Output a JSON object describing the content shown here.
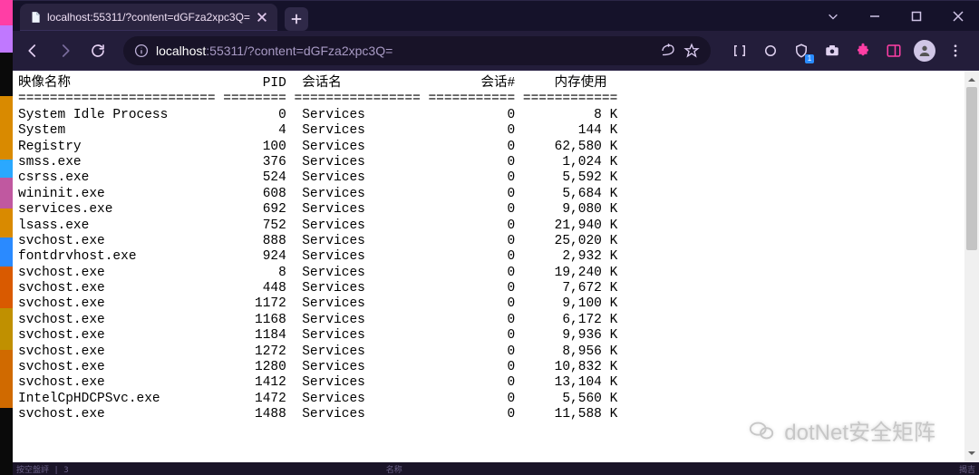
{
  "tab": {
    "title": "localhost:55311/?content=dGFza2xpc3Q="
  },
  "url": {
    "host": "localhost",
    "rest": ":55311/?content=dGFza2xpc3Q="
  },
  "watermark": "dotNet安全矩阵",
  "headers": {
    "name": "映像名称",
    "pid": "PID",
    "session": "会话名",
    "session_num": "会话#",
    "mem": "内存使用"
  },
  "separator": {
    "name": "=========================",
    "pid": "========",
    "session": "================",
    "session_num": "===========",
    "mem": "============"
  },
  "status": {
    "left": "按空盤評 | 3",
    "mid": "名称",
    "right": "揭吉"
  },
  "rows": [
    {
      "name": "System Idle Process",
      "pid": "0",
      "session": "Services",
      "snum": "0",
      "mem": "8 K"
    },
    {
      "name": "System",
      "pid": "4",
      "session": "Services",
      "snum": "0",
      "mem": "144 K"
    },
    {
      "name": "Registry",
      "pid": "100",
      "session": "Services",
      "snum": "0",
      "mem": "62,580 K"
    },
    {
      "name": "smss.exe",
      "pid": "376",
      "session": "Services",
      "snum": "0",
      "mem": "1,024 K"
    },
    {
      "name": "csrss.exe",
      "pid": "524",
      "session": "Services",
      "snum": "0",
      "mem": "5,592 K"
    },
    {
      "name": "wininit.exe",
      "pid": "608",
      "session": "Services",
      "snum": "0",
      "mem": "5,684 K"
    },
    {
      "name": "services.exe",
      "pid": "692",
      "session": "Services",
      "snum": "0",
      "mem": "9,080 K"
    },
    {
      "name": "lsass.exe",
      "pid": "752",
      "session": "Services",
      "snum": "0",
      "mem": "21,940 K"
    },
    {
      "name": "svchost.exe",
      "pid": "888",
      "session": "Services",
      "snum": "0",
      "mem": "25,020 K"
    },
    {
      "name": "fontdrvhost.exe",
      "pid": "924",
      "session": "Services",
      "snum": "0",
      "mem": "2,932 K"
    },
    {
      "name": "svchost.exe",
      "pid": "8",
      "session": "Services",
      "snum": "0",
      "mem": "19,240 K"
    },
    {
      "name": "svchost.exe",
      "pid": "448",
      "session": "Services",
      "snum": "0",
      "mem": "7,672 K"
    },
    {
      "name": "svchost.exe",
      "pid": "1172",
      "session": "Services",
      "snum": "0",
      "mem": "9,100 K"
    },
    {
      "name": "svchost.exe",
      "pid": "1168",
      "session": "Services",
      "snum": "0",
      "mem": "6,172 K"
    },
    {
      "name": "svchost.exe",
      "pid": "1184",
      "session": "Services",
      "snum": "0",
      "mem": "9,936 K"
    },
    {
      "name": "svchost.exe",
      "pid": "1272",
      "session": "Services",
      "snum": "0",
      "mem": "8,956 K"
    },
    {
      "name": "svchost.exe",
      "pid": "1280",
      "session": "Services",
      "snum": "0",
      "mem": "10,832 K"
    },
    {
      "name": "svchost.exe",
      "pid": "1412",
      "session": "Services",
      "snum": "0",
      "mem": "13,104 K"
    },
    {
      "name": "IntelCpHDCPSvc.exe",
      "pid": "1472",
      "session": "Services",
      "snum": "0",
      "mem": "5,560 K"
    },
    {
      "name": "svchost.exe",
      "pid": "1488",
      "session": "Services",
      "snum": "0",
      "mem": "11,588 K"
    }
  ]
}
